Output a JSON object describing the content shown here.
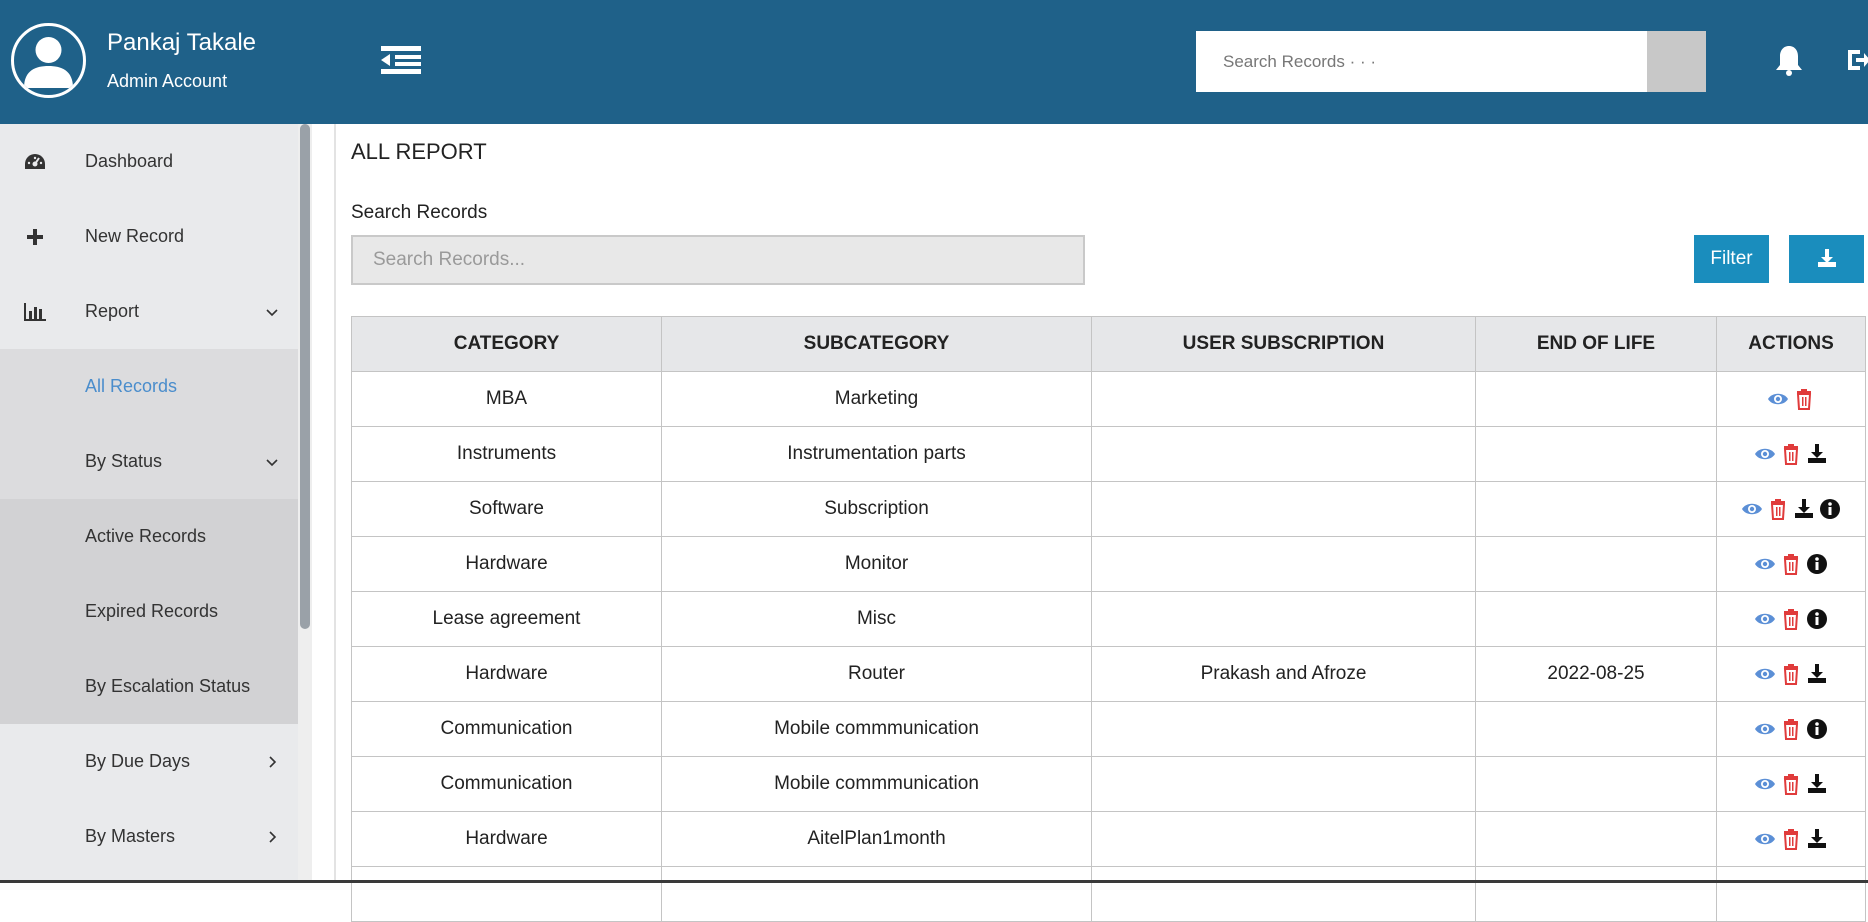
{
  "header": {
    "user_name": "Pankaj Takale",
    "user_role": "Admin Account",
    "search_placeholder": "Search Records · · ·"
  },
  "sidebar": {
    "items": [
      {
        "label": "Dashboard",
        "icon": "dashboard-icon"
      },
      {
        "label": "New Record",
        "icon": "plus-icon"
      },
      {
        "label": "Report",
        "icon": "bar-chart-icon"
      },
      {
        "label": "All Records"
      },
      {
        "label": "By Status"
      },
      {
        "label": "Active Records"
      },
      {
        "label": "Expired Records"
      },
      {
        "label": "By Escalation Status"
      },
      {
        "label": "By Due Days"
      },
      {
        "label": "By Masters"
      }
    ]
  },
  "main": {
    "title": "ALL REPORT",
    "search_label": "Search Records",
    "search_placeholder": "Search Records...",
    "filter_label": "Filter"
  },
  "table": {
    "headers": [
      "CATEGORY",
      "SUBCATEGORY",
      "USER SUBSCRIPTION",
      "END OF LIFE",
      "ACTIONS"
    ],
    "rows": [
      {
        "category": "MBA",
        "subcategory": "Marketing",
        "subscription": "",
        "eol": "",
        "actions": [
          "view",
          "delete"
        ]
      },
      {
        "category": "Instruments",
        "subcategory": "Instrumentation parts",
        "subscription": "",
        "eol": "",
        "actions": [
          "view",
          "delete",
          "download"
        ]
      },
      {
        "category": "Software",
        "subcategory": "Subscription",
        "subscription": "",
        "eol": "",
        "actions": [
          "view",
          "delete",
          "download",
          "info"
        ]
      },
      {
        "category": "Hardware",
        "subcategory": "Monitor",
        "subscription": "",
        "eol": "",
        "actions": [
          "view",
          "delete",
          "info"
        ]
      },
      {
        "category": "Lease agreement",
        "subcategory": "Misc",
        "subscription": "",
        "eol": "",
        "actions": [
          "view",
          "delete",
          "info"
        ]
      },
      {
        "category": "Hardware",
        "subcategory": "Router",
        "subscription": "Prakash and Afroze",
        "eol": "2022-08-25",
        "actions": [
          "view",
          "delete",
          "download"
        ]
      },
      {
        "category": "Communication",
        "subcategory": "Mobile commmunication",
        "subscription": "",
        "eol": "",
        "actions": [
          "view",
          "delete",
          "info"
        ]
      },
      {
        "category": "Communication",
        "subcategory": "Mobile commmunication",
        "subscription": "",
        "eol": "",
        "actions": [
          "view",
          "delete",
          "download"
        ]
      },
      {
        "category": "Hardware",
        "subcategory": "AitelPlan1month",
        "subscription": "",
        "eol": "",
        "actions": [
          "view",
          "delete",
          "download"
        ]
      },
      {
        "category": "",
        "subcategory": "",
        "subscription": "",
        "eol": "",
        "actions": []
      }
    ]
  },
  "colors": {
    "header_bg": "#1f6189",
    "accent": "#1a8dbd",
    "view_icon": "#5b8fd6",
    "delete_icon": "#e03b3b",
    "active_link": "#4a8dcc"
  }
}
